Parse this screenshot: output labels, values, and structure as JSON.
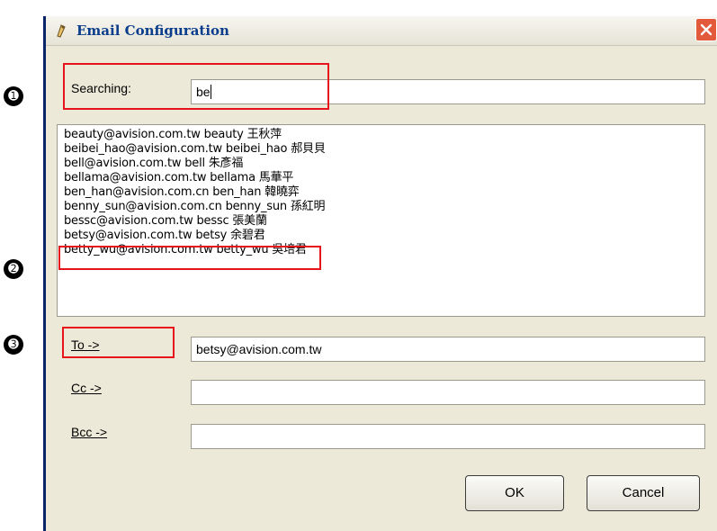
{
  "window": {
    "title": "Email Configuration"
  },
  "callouts": [
    "➊",
    "➋",
    "➌"
  ],
  "search": {
    "label": "Searching:",
    "value": "be"
  },
  "results": [
    "beauty@avision.com.tw beauty 王秋萍",
    "beibei_hao@avision.com.tw beibei_hao 郝貝貝",
    "bell@avision.com.tw bell 朱彥福",
    "bellama@avision.com.tw bellama 馬華平",
    "ben_han@avision.com.cn ben_han 韓曉弈",
    "benny_sun@avision.com.cn benny_sun 孫紅明",
    "bessc@avision.com.tw bessc 張美蘭",
    "betsy@avision.com.tw betsy 余碧君",
    "betty_wu@avision.com.tw betty_wu 吳培君"
  ],
  "recipients": {
    "to": {
      "label": "To ->",
      "value": "betsy@avision.com.tw"
    },
    "cc": {
      "label": "Cc ->",
      "value": ""
    },
    "bcc": {
      "label": "Bcc ->",
      "value": ""
    }
  },
  "buttons": {
    "ok": "OK",
    "cancel": "Cancel"
  },
  "colors": {
    "highlight": "#e8141c",
    "title_text": "#0a3e8c",
    "close_button": "#e2593b"
  }
}
